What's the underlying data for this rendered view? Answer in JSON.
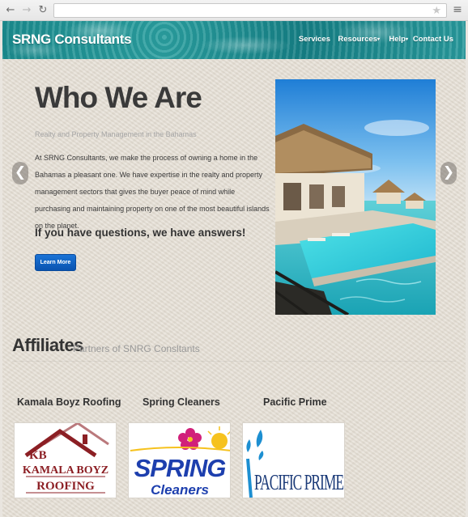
{
  "browser": {
    "back_icon": "arrow-left-icon",
    "forward_icon": "arrow-right-icon",
    "reload_icon": "reload-icon",
    "bookmark_icon": "star-icon",
    "menu_icon": "hamburger-icon",
    "url": ""
  },
  "navbar": {
    "brand": "SRNG Consultants",
    "links": [
      {
        "label": "Services",
        "dropdown": false
      },
      {
        "label": "Resources",
        "dropdown": true
      },
      {
        "label": "Help",
        "dropdown": true
      },
      {
        "label": "Contact Us",
        "dropdown": false
      }
    ]
  },
  "hero": {
    "title": "Who We Are",
    "subtitle": "Realty and Property Management in the Bahamas",
    "body": "At SRNG Consultants, we make the process of owning a home in the Bahamas a pleasant one. We have expertise in the realty and property management sectors that gives the buyer peace of mind while purchasing and maintaining property on one of the most beautiful islands on the planet.",
    "cta": "If you have questions, we have answers!",
    "button_label": "Learn More",
    "prev_arrow": "❮",
    "next_arrow": "❯",
    "button_color": "#0d5ec2"
  },
  "affiliates": {
    "title": "Affiliates",
    "subtitle": "Partners of SNRG Consltants",
    "items": [
      {
        "name": "Kamala Boyz Roofing",
        "logo_initials": "KB",
        "logo_line1": "KAMALA BOYZ",
        "logo_line2": "ROOFING"
      },
      {
        "name": "Spring Cleaners",
        "logo_line1": "SPRING",
        "logo_line2": "Cleaners"
      },
      {
        "name": "Pacific Prime",
        "logo_line1": "PACIFIC PRIME"
      }
    ]
  },
  "colors": {
    "navbar": "#1f9193",
    "page_background": "#e6e0d6",
    "heading": "#3a3a3a",
    "muted": "#a6a6a6"
  }
}
